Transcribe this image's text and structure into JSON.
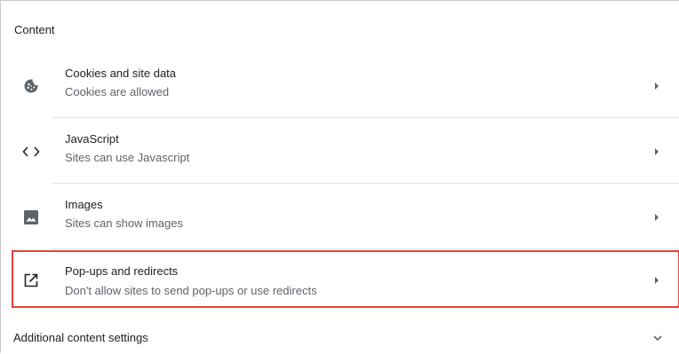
{
  "section": {
    "header": "Content"
  },
  "rows": [
    {
      "title": "Cookies and site data",
      "subtitle": "Cookies are allowed",
      "icon": "cookie-icon"
    },
    {
      "title": "JavaScript",
      "subtitle": "Sites can use Javascript",
      "icon": "code-icon"
    },
    {
      "title": "Images",
      "subtitle": "Sites can show images",
      "icon": "image-icon"
    },
    {
      "title": "Pop-ups and redirects",
      "subtitle": "Don't allow sites to send pop-ups or use redirects",
      "icon": "open-in-new-icon"
    }
  ],
  "additional": {
    "label": "Additional content settings",
    "icon": "chevron-down-icon"
  },
  "colors": {
    "highlight_border": "#e8413e",
    "text_primary": "#202124",
    "text_secondary": "#5f6368",
    "icon": "#5f6368"
  }
}
